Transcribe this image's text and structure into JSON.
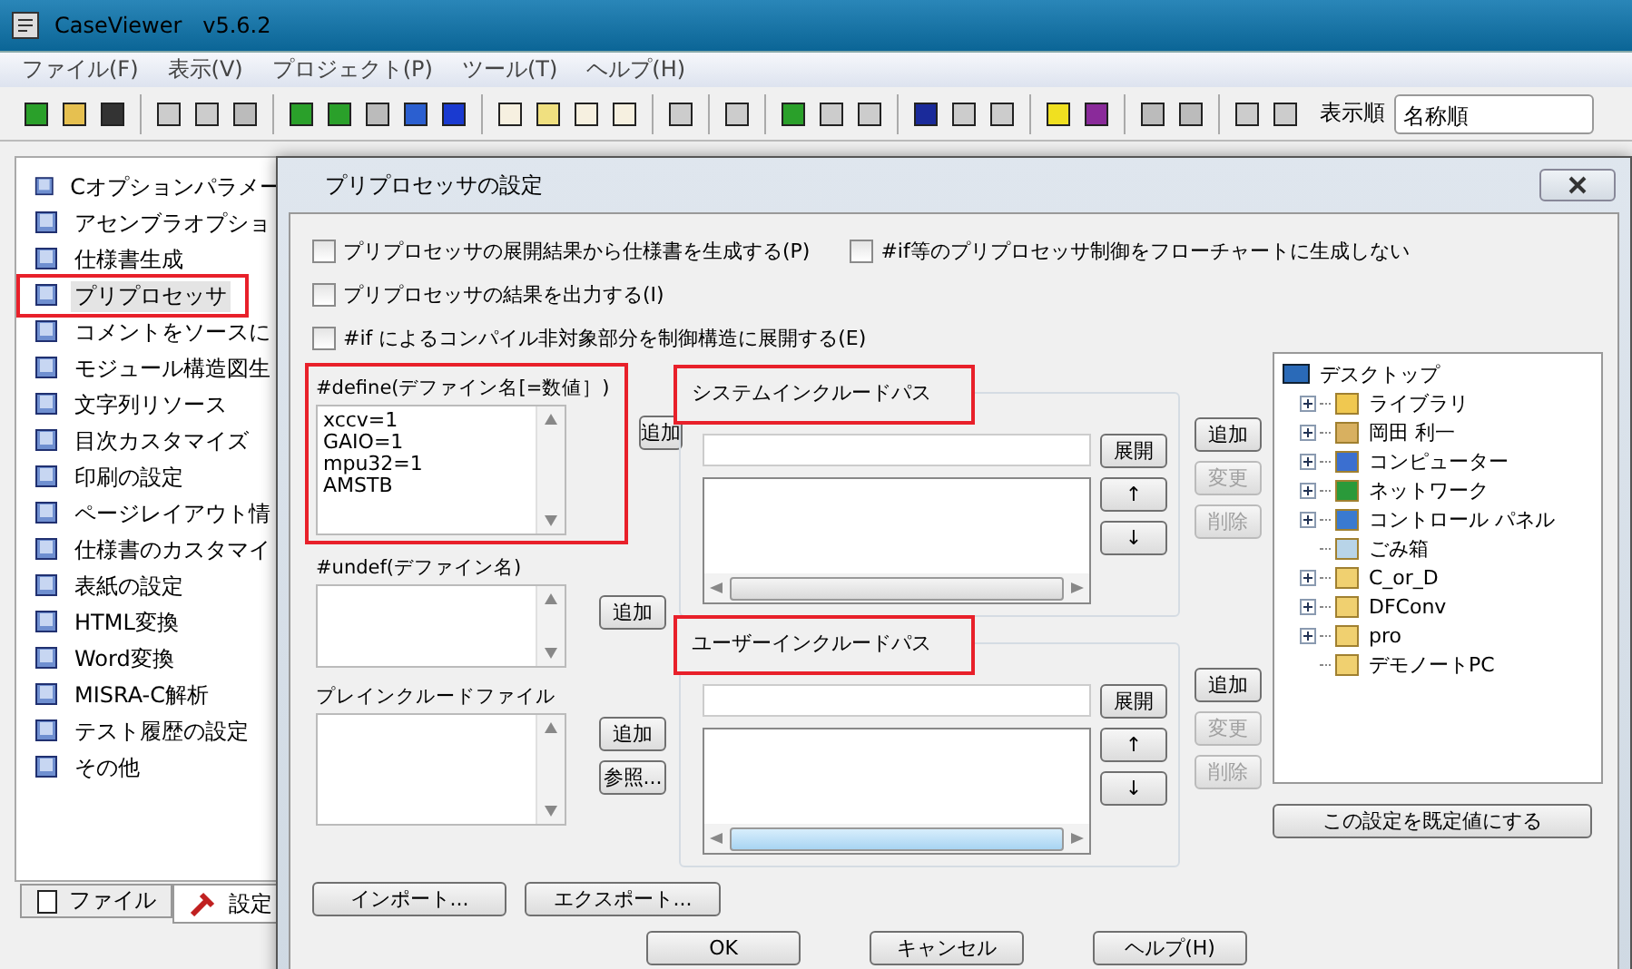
{
  "window": {
    "title": "CaseViewer   v5.6.2"
  },
  "menu": [
    "ファイル(F)",
    "表示(V)",
    "プロジェクト(P)",
    "ツール(T)",
    "ヘルプ(H)"
  ],
  "toolbar": {
    "sort_label": "表示順",
    "sort_value": "名称順"
  },
  "sidebar": {
    "items": [
      {
        "label": "Cオプションパラメー",
        "selected": false,
        "highlighted": false
      },
      {
        "label": "アセンブラオプショ",
        "selected": false,
        "highlighted": false
      },
      {
        "label": "仕様書生成",
        "selected": false,
        "highlighted": false
      },
      {
        "label": "プリプロセッサ",
        "selected": true,
        "highlighted": true
      },
      {
        "label": "コメントをソースに",
        "selected": false,
        "highlighted": false
      },
      {
        "label": "モジュール構造図生",
        "selected": false,
        "highlighted": false
      },
      {
        "label": "文字列リソース",
        "selected": false,
        "highlighted": false
      },
      {
        "label": "目次カスタマイズ",
        "selected": false,
        "highlighted": false
      },
      {
        "label": "印刷の設定",
        "selected": false,
        "highlighted": false
      },
      {
        "label": "ページレイアウト情",
        "selected": false,
        "highlighted": false
      },
      {
        "label": "仕様書のカスタマイ",
        "selected": false,
        "highlighted": false
      },
      {
        "label": "表紙の設定",
        "selected": false,
        "highlighted": false
      },
      {
        "label": "HTML変換",
        "selected": false,
        "highlighted": false
      },
      {
        "label": "Word変換",
        "selected": false,
        "highlighted": false
      },
      {
        "label": "MISRA-C解析",
        "selected": false,
        "highlighted": false
      },
      {
        "label": "テスト履歴の設定",
        "selected": false,
        "highlighted": false
      },
      {
        "label": "その他",
        "selected": false,
        "highlighted": false
      }
    ],
    "tabs": [
      {
        "label": "ファイル",
        "selected": false
      },
      {
        "label": "設定",
        "selected": true
      }
    ]
  },
  "dialog": {
    "title": "プリプロセッサの設定",
    "checkboxes": [
      {
        "label": "プリプロセッサの展開結果から仕様書を生成する(P)",
        "checked": false
      },
      {
        "label": "#if等のプリプロセッサ制御をフローチャートに生成しない",
        "checked": false
      },
      {
        "label": "プリプロセッサの結果を出力する(I)",
        "checked": false
      },
      {
        "label": "#if によるコンパイル非対象部分を制御構造に展開する(E)",
        "checked": false
      }
    ],
    "define": {
      "label": "#define(デファイン名[=数値］)",
      "highlighted": true,
      "lines": [
        "xccv=1",
        "GAIO=1",
        "mpu32=1",
        "AMSTB"
      ],
      "add_button": "追加"
    },
    "undef": {
      "label": "#undef(デファイン名)",
      "add_button": "追加"
    },
    "preinclude": {
      "label": "プレインクルードファイル",
      "add_button": "追加",
      "browse_button": "参照..."
    },
    "import_button": "インポート...",
    "export_button": "エクスポート...",
    "include_groups": [
      {
        "label": "システムインクルードパス",
        "highlighted": true,
        "expand_button": "展開",
        "up_button": "↑",
        "down_button": "↓",
        "buttons": [
          {
            "label": "追加",
            "disabled": false
          },
          {
            "label": "変更",
            "disabled": true
          },
          {
            "label": "削除",
            "disabled": true
          }
        ]
      },
      {
        "label": "ユーザーインクルードパス",
        "highlighted": true,
        "expand_button": "展開",
        "up_button": "↑",
        "down_button": "↓",
        "buttons": [
          {
            "label": "追加",
            "disabled": false
          },
          {
            "label": "変更",
            "disabled": true
          },
          {
            "label": "削除",
            "disabled": true
          }
        ]
      }
    ],
    "tree": {
      "label": "デスクトップ",
      "children": [
        {
          "label": "ライブラリ",
          "expandable": true
        },
        {
          "label": "岡田 利一",
          "expandable": true
        },
        {
          "label": "コンピューター",
          "expandable": true
        },
        {
          "label": "ネットワーク",
          "expandable": true
        },
        {
          "label": "コントロール パネル",
          "expandable": true
        },
        {
          "label": "ごみ箱",
          "expandable": false
        },
        {
          "label": "C_or_D",
          "expandable": true
        },
        {
          "label": "DFConv",
          "expandable": true
        },
        {
          "label": "pro",
          "expandable": true
        },
        {
          "label": "デモノートPC",
          "expandable": false
        }
      ]
    },
    "default_button": "この設定を既定値にする",
    "footer_buttons": [
      "OK",
      "キャンセル",
      "ヘルプ(H)"
    ]
  }
}
